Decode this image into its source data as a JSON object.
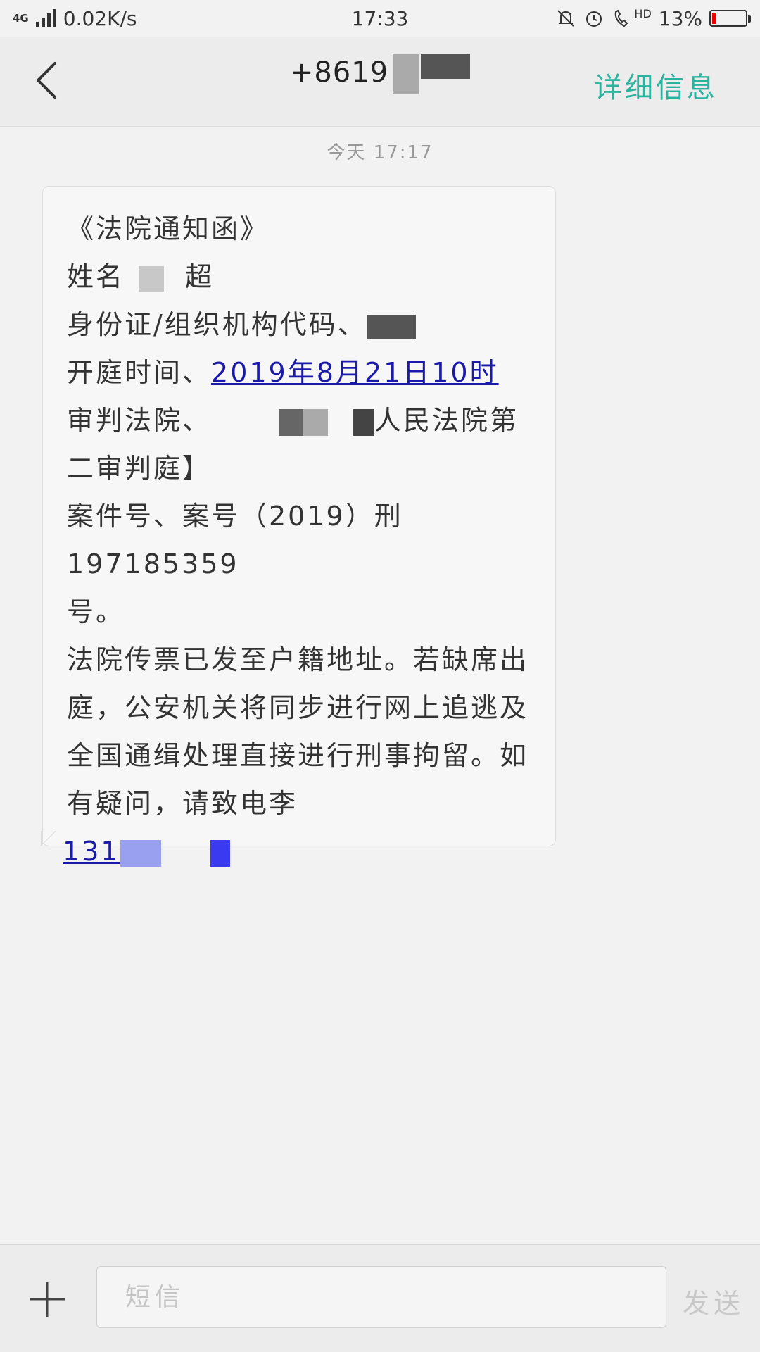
{
  "status_bar": {
    "network_top": "4G",
    "network_top2": "4G",
    "speed": "0.02K/s",
    "time": "17:33",
    "hd_label": "HD",
    "battery_percent": "13%",
    "battery_level": 0.13,
    "icons": [
      "mute-bell-icon",
      "alarm-icon",
      "hd-call-icon",
      "battery-icon"
    ]
  },
  "header": {
    "title": "+8619",
    "details_label": "详细信息"
  },
  "conversation": {
    "timestamp": "今天   17:17",
    "message": {
      "line_title": "《法院通知函》",
      "name_label": "姓名",
      "name_tail": "超",
      "id_label": "身份证/组织机构代码、",
      "hearing_label": "开庭时间、",
      "hearing_time": "2019年8月21日10时",
      "court_label": "审判法院、",
      "court_name_tail": "人民法院第",
      "court_room": "二审判庭】",
      "case_line": "案件号、案号（2019）刑197185359",
      "case_end": "号。",
      "body": "法院传票已发至户籍地址。若缺席出庭，公安机关将同步进行网上追逃及全国通缉处理直接进行刑事拘留。如有疑问，请致电李",
      "phone_prefix": "131"
    }
  },
  "composer": {
    "placeholder": "短信",
    "send_label": "发送"
  }
}
